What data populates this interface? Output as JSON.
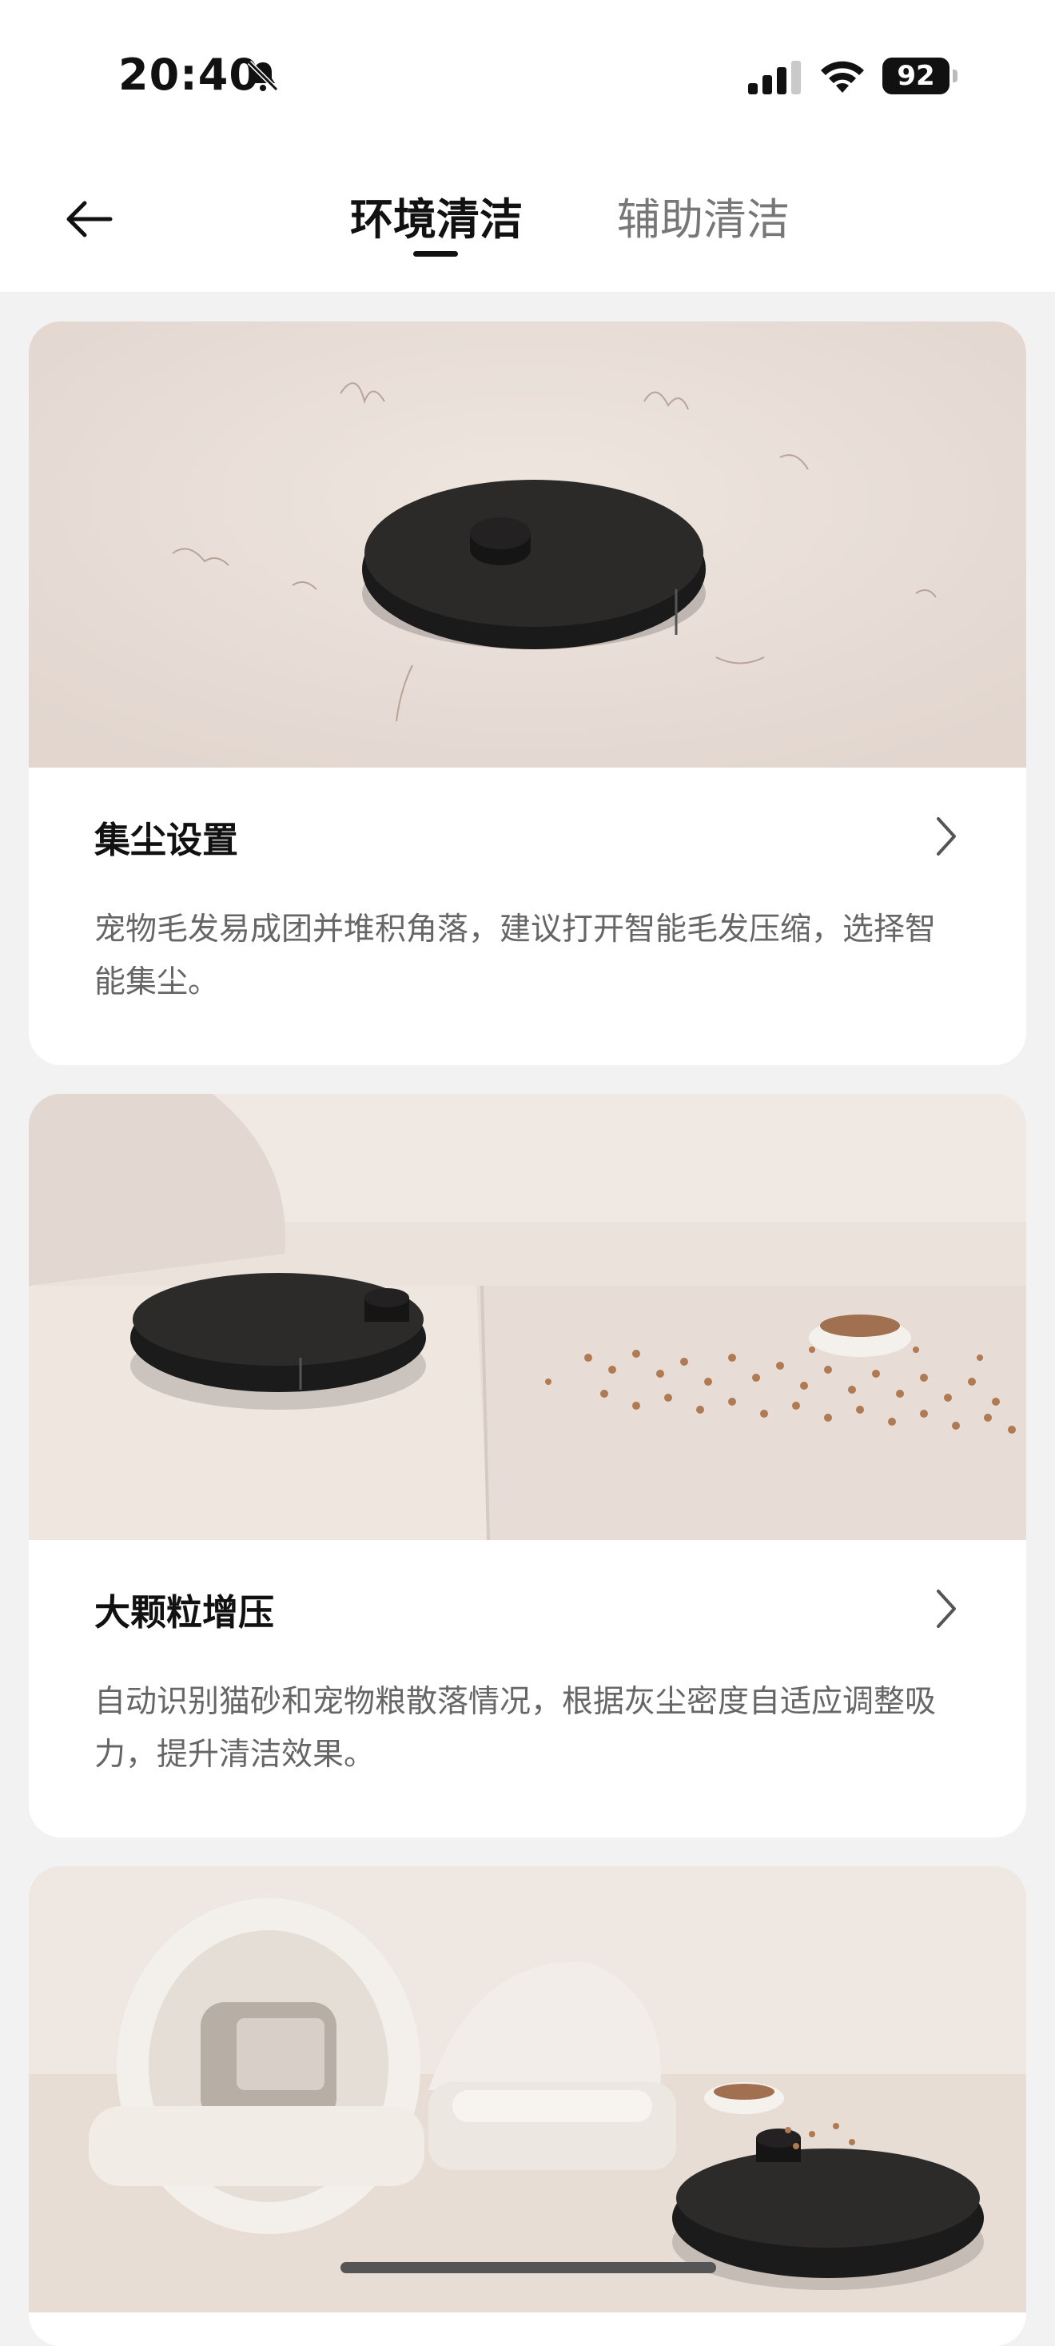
{
  "status_bar": {
    "time": "20:40",
    "battery": "92"
  },
  "header": {
    "tabs": [
      {
        "label": "环境清洁",
        "active": true
      },
      {
        "label": "辅助清洁",
        "active": false
      }
    ]
  },
  "cards": [
    {
      "title": "集尘设置",
      "description": "宠物毛发易成团并堆积角落，建议打开智能毛发压缩，选择智能集尘。"
    },
    {
      "title": "大颗粒增压",
      "description": "自动识别猫砂和宠物粮散落情况，根据灰尘密度自适应调整吸力，提升清洁效果。"
    }
  ],
  "colors": {
    "background": "#f2f2f2",
    "card": "#ffffff",
    "text_primary": "#111111",
    "text_secondary": "#666666",
    "tab_inactive": "#777777"
  }
}
